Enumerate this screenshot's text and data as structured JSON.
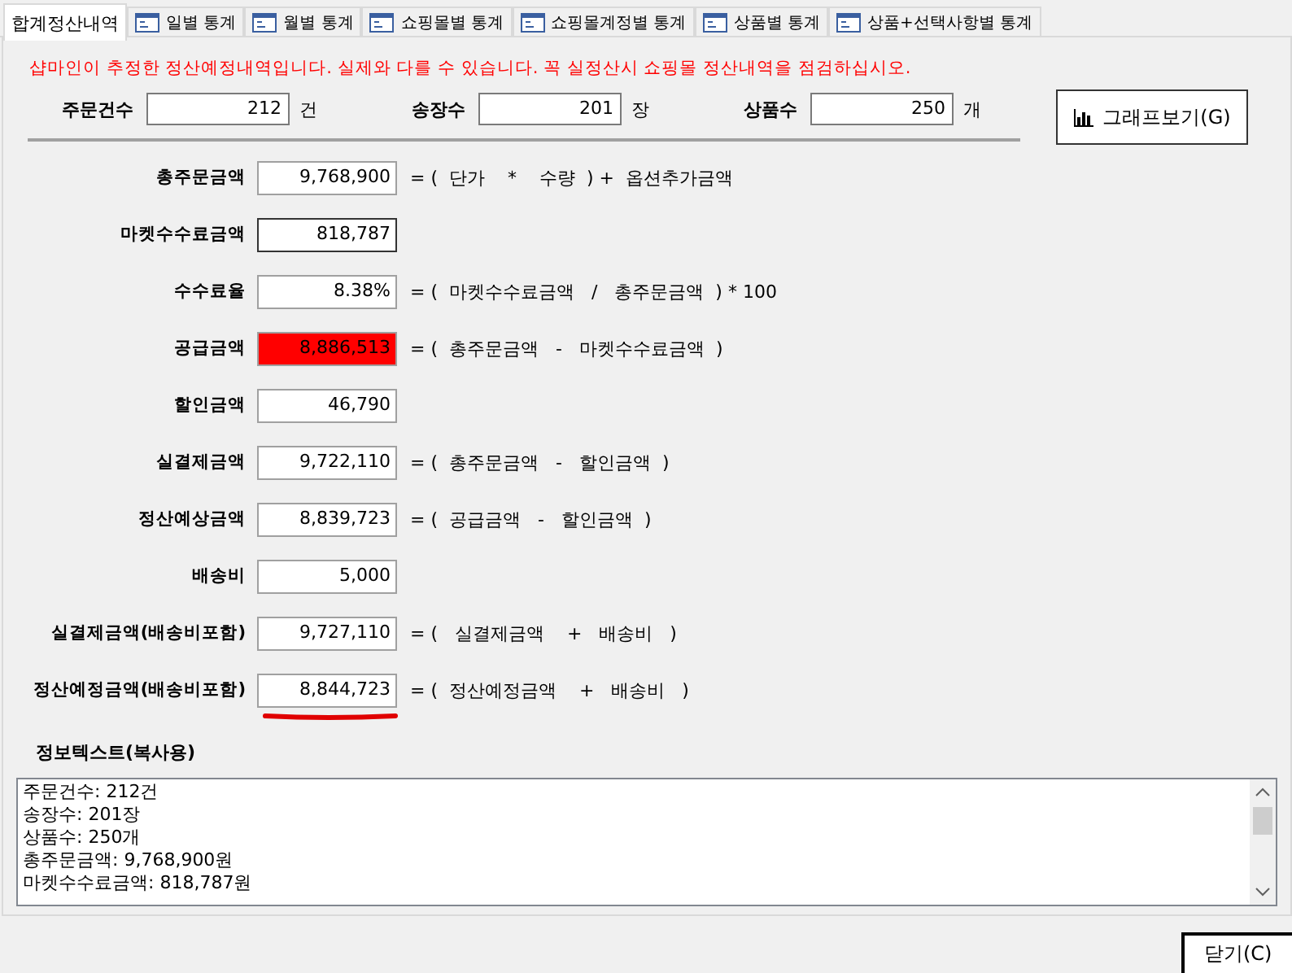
{
  "tabs": [
    {
      "label": "합계정산내역",
      "selected": true,
      "icon": false
    },
    {
      "label": "일별 통계",
      "selected": false,
      "icon": true
    },
    {
      "label": "월별 통계",
      "selected": false,
      "icon": true
    },
    {
      "label": "쇼핑몰별 통계",
      "selected": false,
      "icon": true
    },
    {
      "label": "쇼핑몰계정별 통계",
      "selected": false,
      "icon": true
    },
    {
      "label": "상품별 통계",
      "selected": false,
      "icon": true
    },
    {
      "label": "상품+선택사항별 통계",
      "selected": false,
      "icon": true
    }
  ],
  "notice": "샵마인이 추정한 정산예정내역입니다. 실제와 다를 수 있습니다. 꼭 실정산시 쇼핑몰 정산내역을 점검하십시오.",
  "counts": [
    {
      "label": "주문건수",
      "value": "212",
      "unit": "건"
    },
    {
      "label": "송장수",
      "value": "201",
      "unit": "장"
    },
    {
      "label": "상품수",
      "value": "250",
      "unit": "개"
    }
  ],
  "graph_button": "그래프보기(G)",
  "rows": [
    {
      "label": "총주문금액",
      "value": "9,768,900",
      "formula": "= (  단가    *    수량  ) +  옵션추가금액",
      "highlighted": false,
      "underlined": false,
      "focused": false
    },
    {
      "label": "마켓수수료금액",
      "value": "818,787",
      "highlighted": false,
      "underlined": false,
      "focused": true
    },
    {
      "label": "수수료율",
      "value": "8.38%",
      "formula": "= (  마켓수수료금액   /   총주문금액  ) * 100",
      "highlighted": false,
      "underlined": false,
      "focused": false
    },
    {
      "label": "공급금액",
      "value": "8,886,513",
      "formula": "= (  총주문금액   -   마켓수수료금액  )",
      "highlighted": true,
      "underlined": false,
      "focused": false
    },
    {
      "label": "할인금액",
      "value": "46,790",
      "highlighted": false,
      "underlined": false,
      "focused": false
    },
    {
      "label": "실결제금액",
      "value": "9,722,110",
      "formula": "= (  총주문금액   -   할인금액  )",
      "highlighted": false,
      "underlined": false,
      "focused": false
    },
    {
      "label": "정산예상금액",
      "value": "8,839,723",
      "formula": "= (  공급금액   -   할인금액  )",
      "highlighted": false,
      "underlined": false,
      "focused": false
    },
    {
      "label": "배송비",
      "value": "5,000",
      "highlighted": false,
      "underlined": false,
      "focused": false
    },
    {
      "label": "실결제금액(배송비포함)",
      "value": "9,727,110",
      "formula": "= (   실결제금액    +   배송비   )",
      "highlighted": false,
      "underlined": false,
      "focused": false
    },
    {
      "label": "정산예정금액(배송비포함)",
      "value": "8,844,723",
      "formula": "= (  정산예정금액    +   배송비   )",
      "highlighted": false,
      "underlined": true,
      "focused": false
    }
  ],
  "info": {
    "label": "정보텍스트(복사용)",
    "lines": [
      "주문건수: 212건",
      "송장수: 201장",
      "상품수: 250개",
      "총주문금액: 9,768,900원",
      "마켓수수료금액: 818,787원"
    ]
  },
  "close_button": "닫기(C)"
}
